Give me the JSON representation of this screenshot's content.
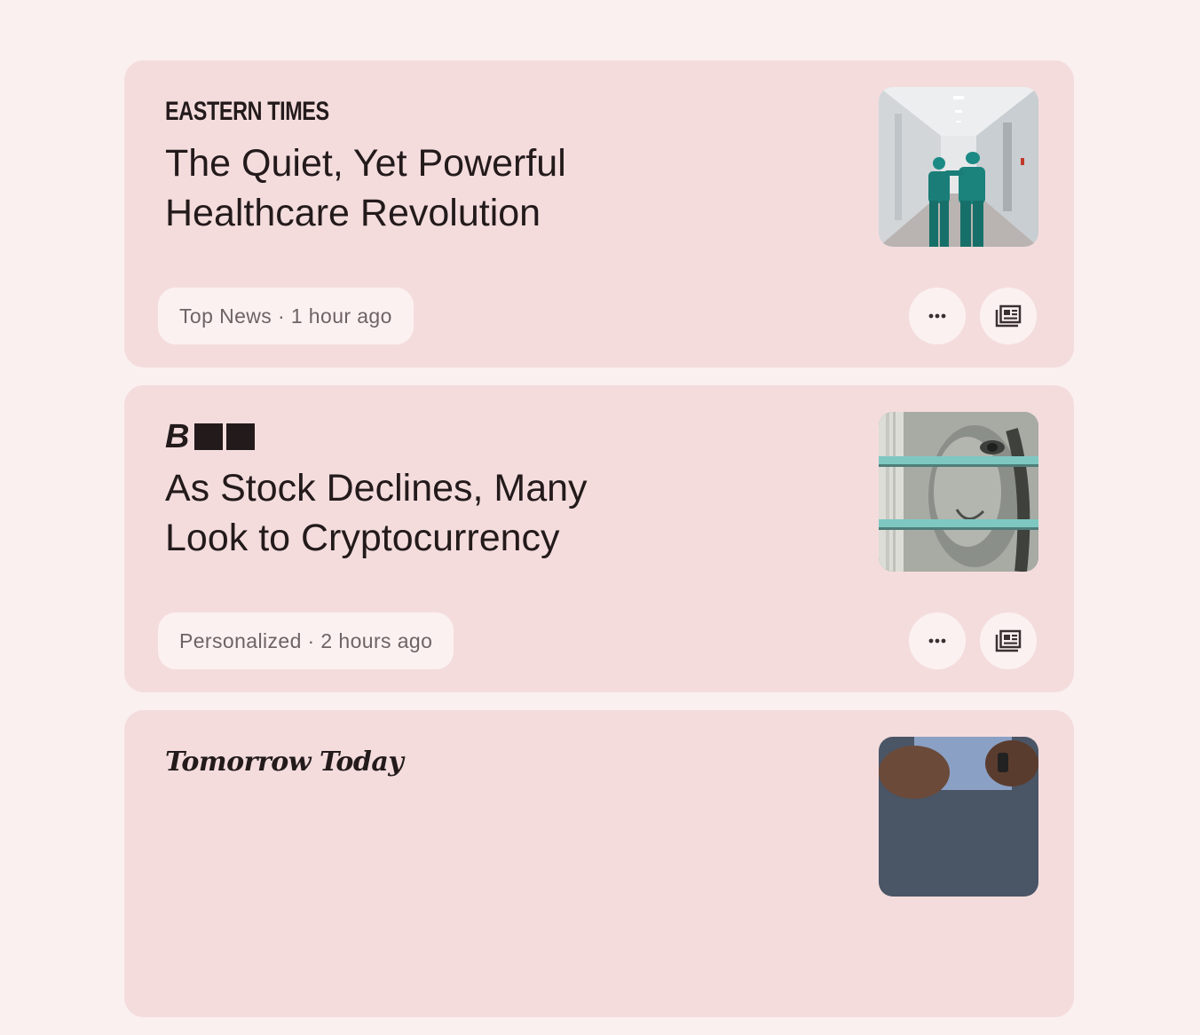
{
  "articles": [
    {
      "source": "EASTERN TIMES",
      "source_style": "condensed-bold",
      "headline": "The Quiet, Yet Powerful Healthcare Revolution",
      "meta": "Top News · 1 hour ago",
      "thumbnail": "hospital-corridor-nurses-photo"
    },
    {
      "source": "B",
      "source_style": "bold-italic-with-blocks",
      "headline": "As Stock Declines, Many Look to Cryptocurrency",
      "meta": "Personalized · 2 hours ago",
      "thumbnail": "dollar-bill-stack-photo"
    },
    {
      "source": "Tomorrow Today",
      "source_style": "blackletter",
      "headline": "",
      "meta": "",
      "thumbnail": "hands-with-phone-photo"
    }
  ],
  "icons": {
    "more": "more-horiz-icon",
    "full_coverage": "newspaper-icon"
  },
  "colors": {
    "background": "#fbf0f0",
    "card": "#f4dcdd",
    "chip": "#fcf1f1",
    "text_primary": "#231a1b",
    "text_secondary": "#6f6264"
  }
}
